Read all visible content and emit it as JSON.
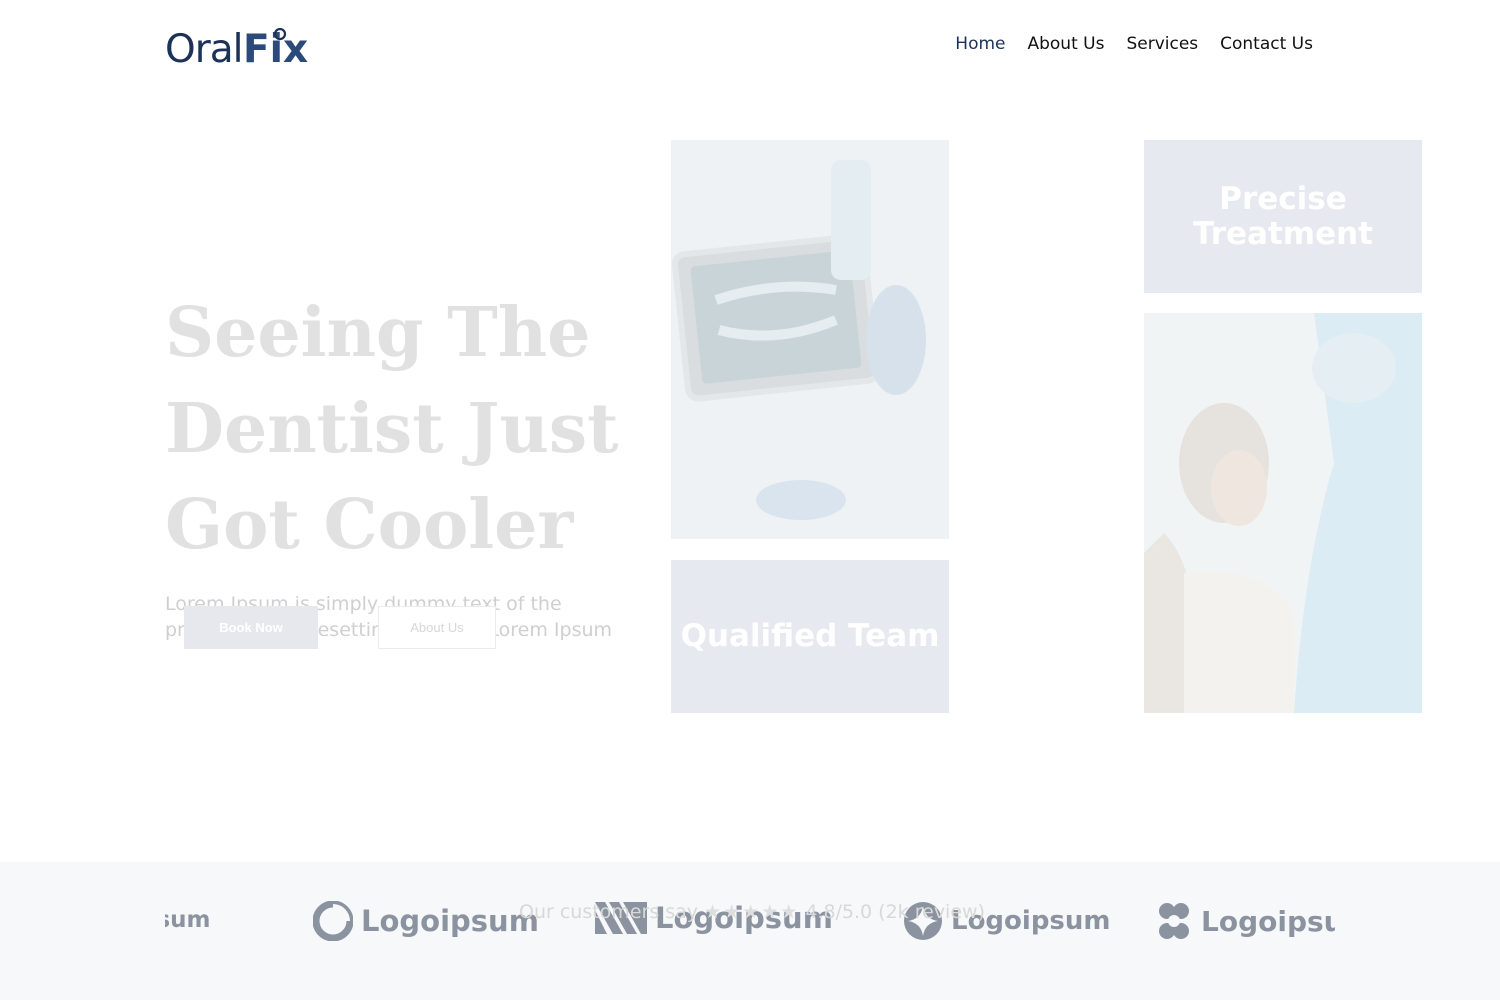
{
  "header": {
    "logo": {
      "part1": "Oral",
      "part2": "Fix"
    },
    "nav": [
      {
        "label": "Home",
        "active": true
      },
      {
        "label": "About Us",
        "active": false
      },
      {
        "label": "Services",
        "active": false
      },
      {
        "label": "Contact Us",
        "active": false
      }
    ]
  },
  "hero": {
    "title_line1": "Seeing The",
    "title_line2": "Dentist Just",
    "title_line3": "Got Cooler",
    "subtitle": "Lorem Ipsum is simply dummy text of the printing and typesetting industry. Lorem Ipsum",
    "primary_button": "Book Now",
    "secondary_button": "About Us"
  },
  "cards": {
    "qualified": "Qualified Team",
    "precise": "Precise Treatment"
  },
  "review": {
    "prefix": "Our customers say",
    "stars": "★★★★★",
    "rating": "4.8/5.0 (2k review)"
  },
  "logos": {
    "partial": "psum",
    "brand1": "Logoipsum",
    "brand2": "Logoipsum",
    "brand3": "Logoipsum",
    "brand4": "Logoipsum"
  },
  "colors": {
    "brand": "#1d3259",
    "card": "#e6e9ef",
    "logo_gray": "#8b93a0"
  }
}
